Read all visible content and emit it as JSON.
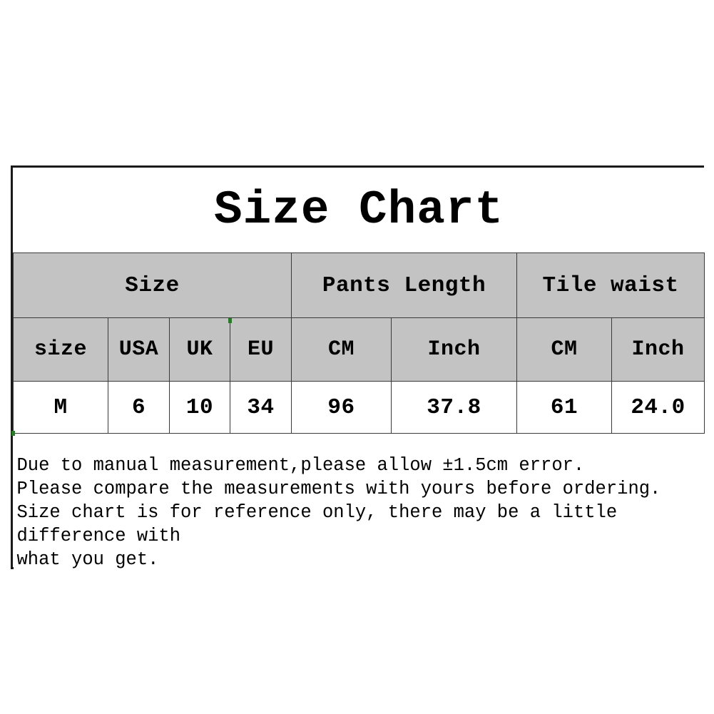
{
  "title": "Size Chart",
  "table": {
    "group_headers": [
      {
        "label": "Size",
        "span": 4
      },
      {
        "label": "Pants Length",
        "span": 2
      },
      {
        "label": "Tile waist",
        "span": 2
      }
    ],
    "sub_headers": [
      "size",
      "USA",
      "UK",
      "EU",
      "CM",
      "Inch",
      "CM",
      "Inch"
    ],
    "rows": [
      [
        "M",
        "6",
        "10",
        "34",
        "96",
        "37.8",
        "61",
        "24.0"
      ]
    ]
  },
  "notes": [
    "Due to manual measurement,please allow ±1.5cm error.",
    "Please compare the measurements with yours before ordering.",
    "Size chart is for reference only, there may be a little difference with",
    "what you get."
  ],
  "colors": {
    "header_gray": "#c3c3c3",
    "body_white": "#ffffff",
    "border": "#1a1a1a",
    "text": "#000000"
  },
  "chart_data": {
    "type": "table",
    "title": "Size Chart",
    "columns": [
      "size",
      "USA",
      "UK",
      "EU",
      "CM",
      "Inch",
      "CM",
      "Inch"
    ],
    "column_groups": [
      "Size",
      "Size",
      "Size",
      "Size",
      "Pants Length",
      "Pants Length",
      "Tile waist",
      "Tile waist"
    ],
    "rows": [
      {
        "size": "M",
        "USA": 6,
        "UK": 10,
        "EU": 34,
        "pants_length_cm": 96,
        "pants_length_inch": 37.8,
        "tile_waist_cm": 61,
        "tile_waist_inch": 24.0
      }
    ],
    "notes": [
      "Due to manual measurement,please allow ±1.5cm error.",
      "Please compare the measurements with yours before ordering.",
      "Size chart is for reference only, there may be a little difference with what you get."
    ]
  }
}
